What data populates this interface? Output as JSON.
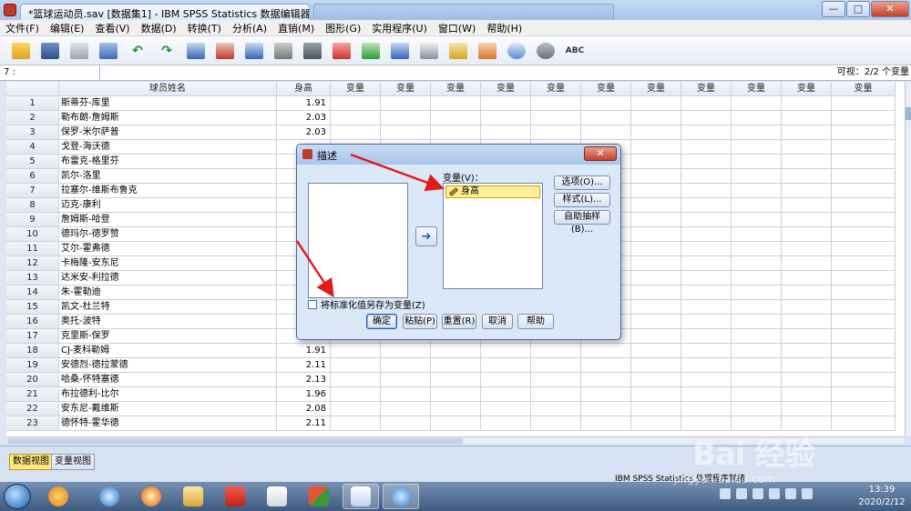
{
  "window": {
    "tab1_title": "*篮球运动员.sav [数据集1] - IBM SPSS Statistics 数据编辑器",
    "tab2_title": "",
    "minimize": "—",
    "maximize": "□",
    "close": "✕"
  },
  "menu": [
    "文件(F)",
    "编辑(E)",
    "查看(V)",
    "数据(D)",
    "转换(T)",
    "分析(A)",
    "直销(M)",
    "图形(G)",
    "实用程序(U)",
    "窗口(W)",
    "帮助(H)"
  ],
  "cellbar": {
    "ref": "7 :",
    "visible": "可视：2/2 个变量"
  },
  "grid": {
    "headers": [
      "球员姓名",
      "身高",
      "变量",
      "变量",
      "变量",
      "变量",
      "变量",
      "变量",
      "变量",
      "变量",
      "变量",
      "变量",
      "变量"
    ],
    "rows": [
      {
        "n": "1",
        "name": "斯蒂芬-库里",
        "height": "1.91"
      },
      {
        "n": "2",
        "name": "勒布朗-詹姆斯",
        "height": "2.03"
      },
      {
        "n": "3",
        "name": "保罗-米尔萨普",
        "height": "2.03"
      },
      {
        "n": "4",
        "name": "戈登-海沃德",
        "height": ""
      },
      {
        "n": "5",
        "name": "布雷克-格里芬",
        "height": ""
      },
      {
        "n": "6",
        "name": "凯尔-洛里",
        "height": ""
      },
      {
        "n": "7",
        "name": "拉塞尔-维斯布鲁克",
        "height": ""
      },
      {
        "n": "8",
        "name": "迈克-康利",
        "height": ""
      },
      {
        "n": "9",
        "name": "詹姆斯-哈登",
        "height": ""
      },
      {
        "n": "10",
        "name": "德玛尔-德罗赞",
        "height": ""
      },
      {
        "n": "11",
        "name": "艾尔-霍弗德",
        "height": ""
      },
      {
        "n": "12",
        "name": "卡梅隆-安东尼",
        "height": ""
      },
      {
        "n": "13",
        "name": "达米安-利拉德",
        "height": ""
      },
      {
        "n": "14",
        "name": "朱-霍勒迪",
        "height": ""
      },
      {
        "n": "15",
        "name": "凯文-杜兰特",
        "height": ""
      },
      {
        "n": "16",
        "name": "奥托-波特",
        "height": ""
      },
      {
        "n": "17",
        "name": "克里斯-保罗",
        "height": ""
      },
      {
        "n": "18",
        "name": "CJ-麦科勒姆",
        "height": "1.91"
      },
      {
        "n": "19",
        "name": "安德烈-德拉蒙德",
        "height": "2.11"
      },
      {
        "n": "20",
        "name": "哈桑-怀特塞德",
        "height": "2.13"
      },
      {
        "n": "21",
        "name": "布拉德利-比尔",
        "height": "1.96"
      },
      {
        "n": "22",
        "name": "安东尼-戴维斯",
        "height": "2.08"
      },
      {
        "n": "23",
        "name": "德怀特-霍华德",
        "height": "2.11"
      }
    ]
  },
  "view_tabs": {
    "data": "数据视图",
    "variable": "变量视图"
  },
  "status": "IBM SPSS Statistics 处理程序就绪",
  "dialog": {
    "title": "描述",
    "target_label": "变量(V)：",
    "target_item": "身高",
    "move_arrow": "➜",
    "options": "选项(O)...",
    "style": "样式(L)...",
    "bootstrap": "自助抽样(B)...",
    "save_std": "将标准化值另存为变量(Z)",
    "ok": "确定",
    "paste": "粘贴(P)",
    "reset": "重置(R)",
    "cancel": "取消",
    "help": "帮助"
  },
  "clock": {
    "time": "13:39",
    "date": "2020/2/12"
  },
  "watermark": {
    "brand": "Bai 经验",
    "url": "jingyan.baidu.com"
  }
}
